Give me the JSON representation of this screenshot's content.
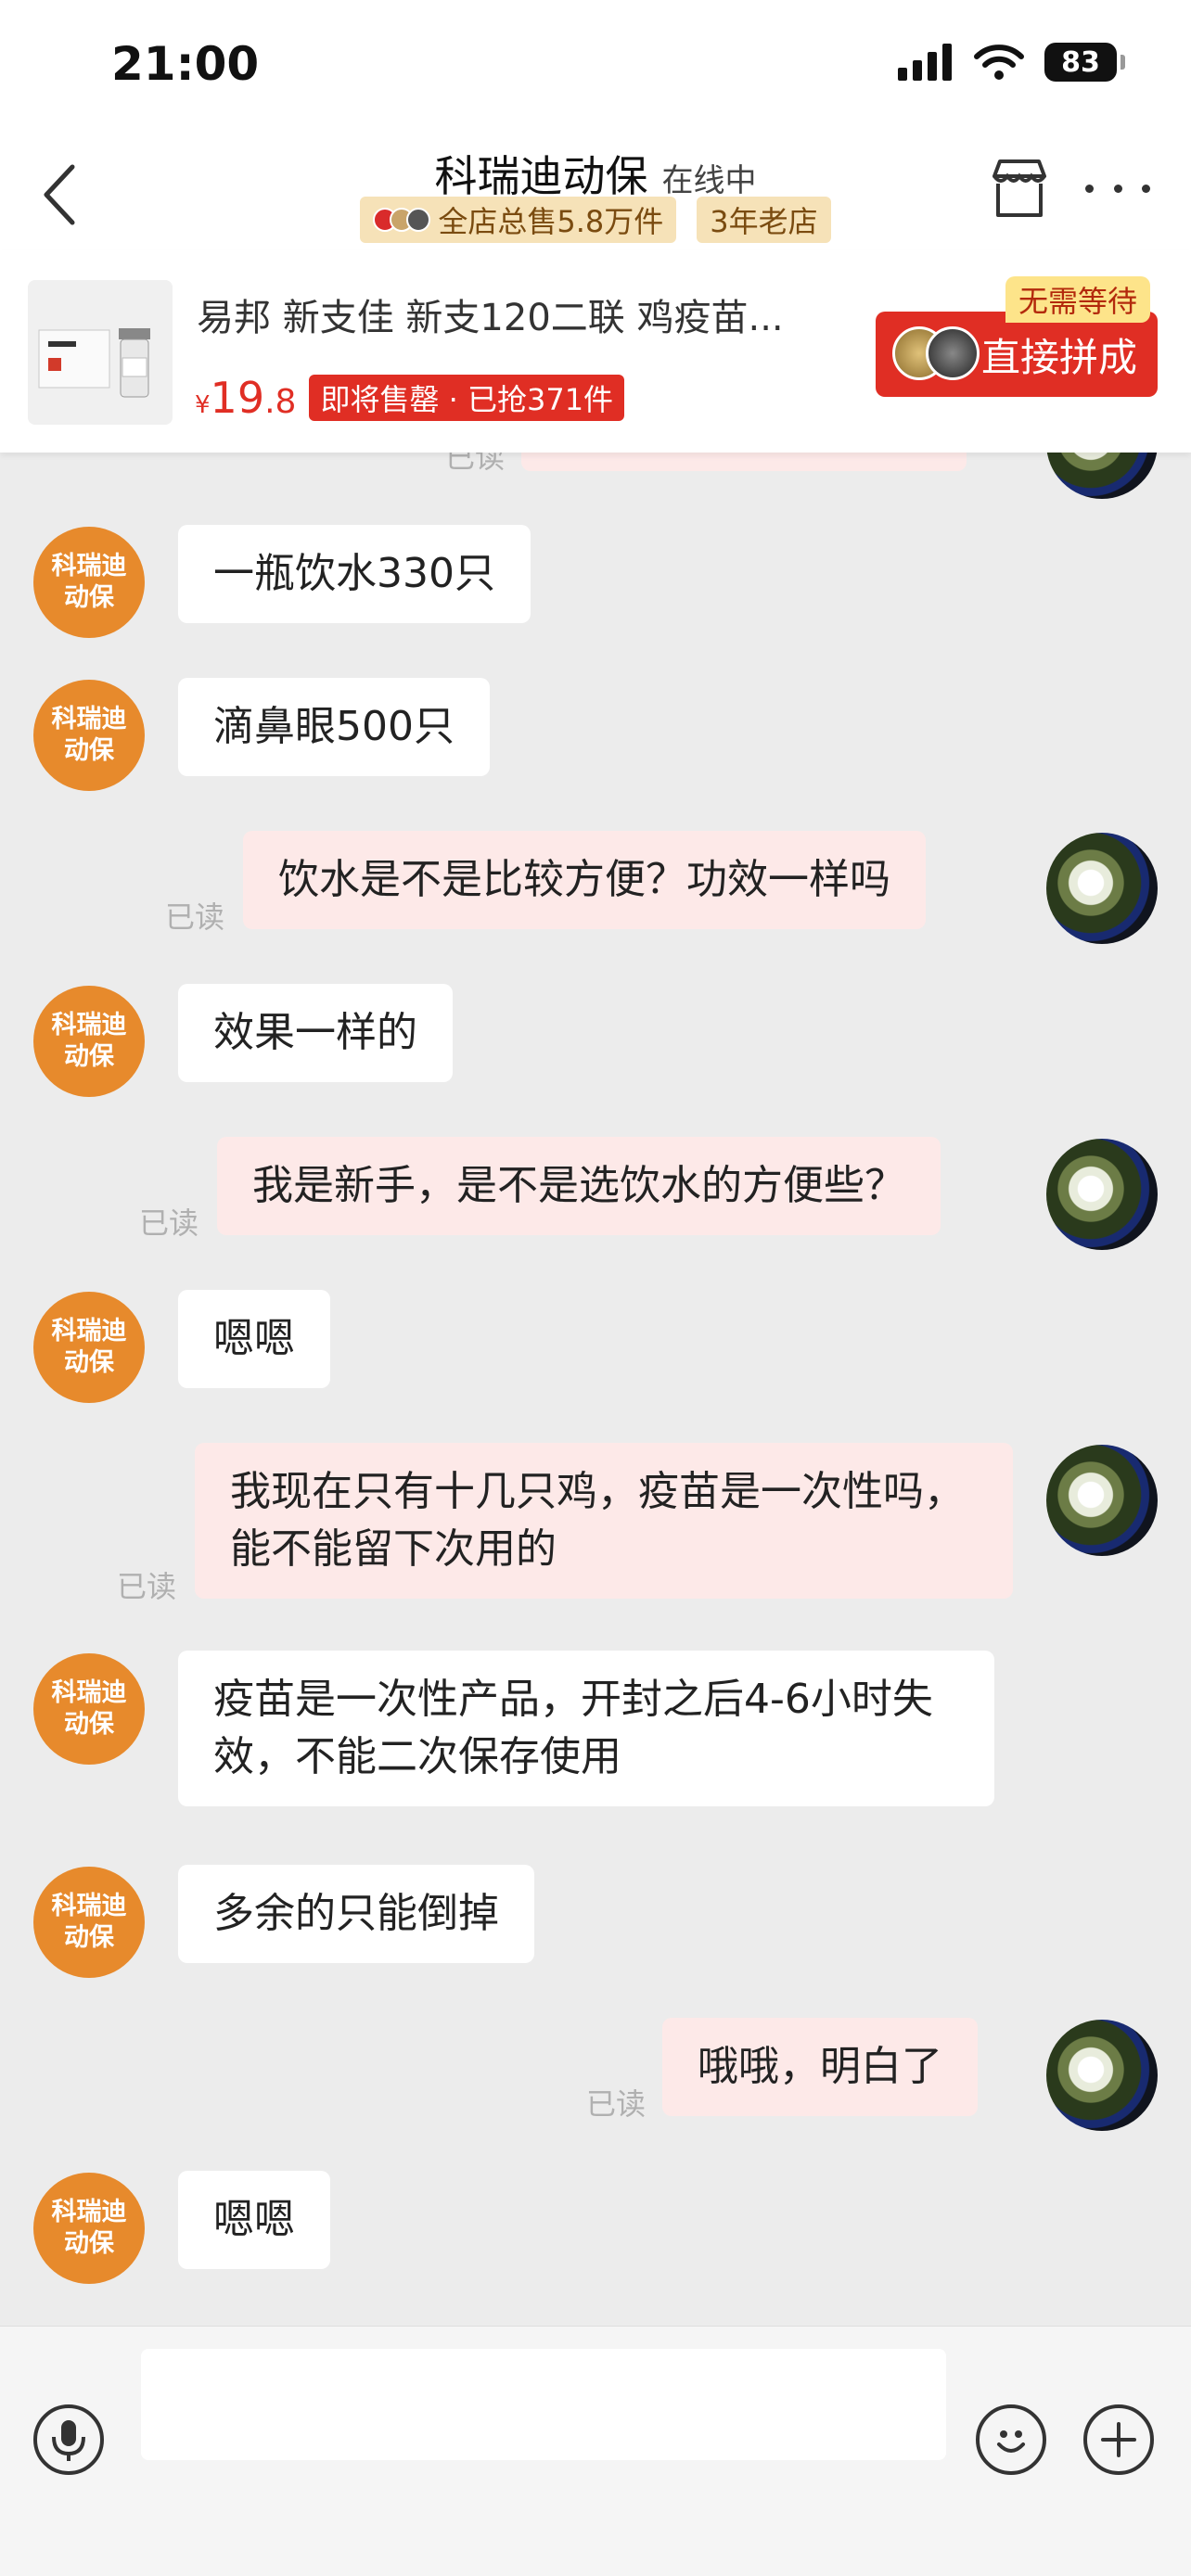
{
  "status_bar": {
    "time": "21:00",
    "battery": "83"
  },
  "header": {
    "shop_name": "科瑞迪动保",
    "online_status": "在线中",
    "badge_sales": "全店总售5.8万件",
    "badge_years": "3年老店"
  },
  "product": {
    "title": "易邦 新支佳 新支120二联 鸡疫苗...",
    "currency": "¥",
    "price_int": "19",
    "price_dec": ".8",
    "sale_tag": "即将售罄 · 已抢371件",
    "wait_tag": "无需等待",
    "buy_label": "直接拼成"
  },
  "shop_avatar": {
    "line1": "科瑞迪",
    "line2": "动保"
  },
  "messages": [
    {
      "side": "in",
      "text": "一瓶饮水330只"
    },
    {
      "side": "in",
      "text": "滴鼻眼500只"
    },
    {
      "side": "out",
      "text": "饮水是不是比较方便？功效一样吗",
      "status": "已读"
    },
    {
      "side": "in",
      "text": "效果一样的"
    },
    {
      "side": "out",
      "text": "我是新手，是不是选饮水的方便些？",
      "status": "已读"
    },
    {
      "side": "in",
      "text": "嗯嗯"
    },
    {
      "side": "out",
      "text": "我现在只有十几只鸡，疫苗是一次性吗，能不能留下次用的",
      "status": "已读"
    },
    {
      "side": "in",
      "text": "疫苗是一次性产品，开封之后4-6小时失效，不能二次保存使用"
    },
    {
      "side": "in",
      "text": "多余的只能倒掉"
    },
    {
      "side": "out",
      "text": "哦哦，明白了",
      "status": "已读"
    },
    {
      "side": "in",
      "text": "嗯嗯"
    }
  ],
  "input": {
    "placeholder": ""
  },
  "colors": {
    "accent_red": "#e02e24",
    "shop_avatar": "#e78a2c",
    "out_bubble": "#fde9e8"
  }
}
